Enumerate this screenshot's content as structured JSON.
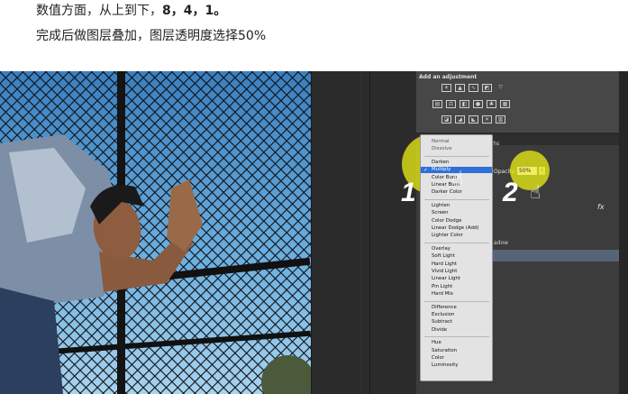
{
  "instructions": {
    "line1_prefix": "数值方面，从上到下，",
    "line1_values": "8，4，1。",
    "line2": "完成后做图层叠加，图层透明度选择50%"
  },
  "adjustments": {
    "title": "Add an adjustment"
  },
  "layers_panel": {
    "tab_label": "ths",
    "opacity_label": "Opacity:",
    "opacity_value": "50%",
    "fx_label": "fx",
    "row_text": "adow"
  },
  "blend_menu": {
    "groups": [
      [
        "Normal",
        "Dissolve"
      ],
      [
        "Darken",
        "Multiply",
        "Color Burn",
        "Linear Burn",
        "Darker Color"
      ],
      [
        "Lighten",
        "Screen",
        "Color Dodge",
        "Linear Dodge (Add)",
        "Lighter Color"
      ],
      [
        "Overlay",
        "Soft Light",
        "Hard Light",
        "Vivid Light",
        "Linear Light",
        "Pin Light",
        "Hard Mix"
      ],
      [
        "Difference",
        "Exclusion",
        "Subtract",
        "Divide"
      ],
      [
        "Hue",
        "Saturation",
        "Color",
        "Luminosity"
      ]
    ],
    "selected": "Multiply"
  },
  "annotations": {
    "step1": "1",
    "step2": "2"
  },
  "colors": {
    "highlight": "#e6e814",
    "selection": "#2f6fd6",
    "panel": "#474747"
  }
}
